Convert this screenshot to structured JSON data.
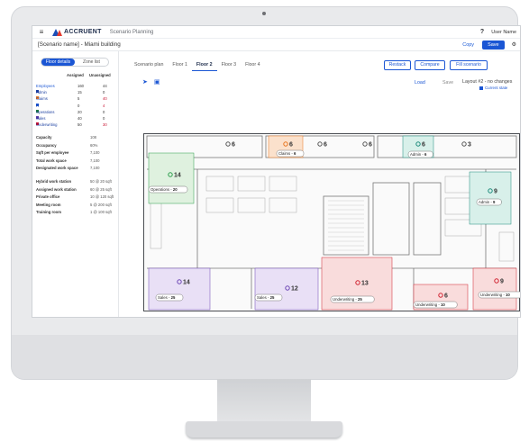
{
  "app": {
    "logo_text": "ACCRUENT",
    "title": "Scenario Planning",
    "help": "?",
    "user_name": "User Name"
  },
  "subbar": {
    "scenario_name": "[Scenario name] - Miami building",
    "copy_label": "Copy",
    "save_label": "Save"
  },
  "sidebar": {
    "toggle": {
      "active": "Floor details",
      "inactive": "Zone list"
    },
    "legend_headers": {
      "assigned": "Assigned",
      "unassigned": "Unassigned"
    },
    "rows": [
      {
        "label": "Employees",
        "assigned": "160",
        "unassigned": "44",
        "color": ""
      },
      {
        "label": "Admin",
        "assigned": "15",
        "unassigned": "0",
        "color": "#1b3fa0"
      },
      {
        "label": "Claims",
        "assigned": "5",
        "unassigned": "40",
        "color": "#e8741c"
      },
      {
        "label": "IT",
        "assigned": "0",
        "unassigned": "4",
        "color": "#1b56d4"
      },
      {
        "label": "Operations",
        "assigned": "20",
        "unassigned": "0",
        "color": "#1e7d3c"
      },
      {
        "label": "Sales",
        "assigned": "40",
        "unassigned": "0",
        "color": "#5b3aa6"
      },
      {
        "label": "Underwriting",
        "assigned": "50",
        "unassigned": "30",
        "color": "#c8102e"
      }
    ],
    "stats_a": [
      {
        "key": "Capacity",
        "value": "108"
      },
      {
        "key": "Occupancy",
        "value": "60%"
      },
      {
        "key": "Sqft per employee",
        "value": "7,100"
      },
      {
        "key": "Total work space",
        "value": "7,100"
      },
      {
        "key": "Designated work space",
        "value": "7,100"
      }
    ],
    "stats_b": [
      {
        "key": "Hybrid work station",
        "value": "50 @ 20 sqft"
      },
      {
        "key": "Assigned work station",
        "value": "60 @ 25 sqft"
      },
      {
        "key": "Private office",
        "value": "10 @ 120 sqft"
      },
      {
        "key": "Meeting room",
        "value": "5 @ 200 sqft"
      },
      {
        "key": "Training room",
        "value": "1 @ 100 sqft"
      }
    ]
  },
  "tabs": [
    {
      "label": "Scenario plan",
      "active": false
    },
    {
      "label": "Floor 1",
      "active": false
    },
    {
      "label": "Floor 2",
      "active": true
    },
    {
      "label": "Floor 3",
      "active": false
    },
    {
      "label": "Floor 4",
      "active": false
    }
  ],
  "actions": {
    "restack": "Restack",
    "compare": "Compare",
    "fill": "Fill scenario"
  },
  "tools": {
    "pointer_icon": "cursor-arrow-icon",
    "select_icon": "select-area-icon"
  },
  "floor_toolbar": {
    "load": "Load",
    "save": "Save",
    "layout_status": "Layout #2 - no changes",
    "current_state": "Current state"
  },
  "plan": {
    "zones": [
      {
        "name": "Operations",
        "count": "20",
        "seats": "14",
        "color": "#2a9d4a",
        "fill": "#dff1df"
      },
      {
        "name": "Claims",
        "count": "6",
        "seats": "6",
        "color": "#e8741c",
        "fill": "#fbe1cc"
      },
      {
        "name": "Admin",
        "count": "6",
        "seats": "6",
        "color": "#1b8a7a",
        "fill": "#d8f0ea"
      },
      {
        "name": "Admin",
        "count": "9",
        "seats": "9",
        "color": "#1b8a7a",
        "fill": "#d8f0ea"
      },
      {
        "name": "Sales",
        "count": "25",
        "seats": "14",
        "color": "#6b45b4",
        "fill": "#e9e0f6"
      },
      {
        "name": "Sales",
        "count": "25",
        "seats": "12",
        "color": "#6b45b4",
        "fill": "#e9e0f6"
      },
      {
        "name": "Underwriting",
        "count": "25",
        "seats": "13",
        "color": "#d0202e",
        "fill": "#f9dcdc"
      },
      {
        "name": "Underwriting",
        "count": "10",
        "seats": "6",
        "color": "#d0202e",
        "fill": "#f9dcdc"
      },
      {
        "name": "Underwriting",
        "count": "10",
        "seats": "9",
        "color": "#d0202e",
        "fill": "#f9dcdc"
      }
    ],
    "neutral_counts": [
      "6",
      "6",
      "6",
      "3"
    ]
  }
}
